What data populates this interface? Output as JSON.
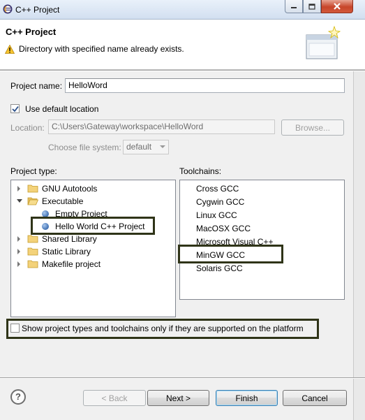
{
  "window": {
    "title": "C++ Project",
    "close_glyph": "x"
  },
  "header": {
    "title": "C++ Project",
    "message": "Directory with specified name already exists."
  },
  "project_name": {
    "label": "Project name:",
    "value": "HelloWord"
  },
  "use_default_location": {
    "label": "Use default location",
    "checked": true
  },
  "location": {
    "label": "Location:",
    "value": "C:\\Users\\Gateway\\workspace\\HelloWord",
    "browse_label": "Browse..."
  },
  "file_system": {
    "label": "Choose file system:",
    "value": "default"
  },
  "project_type": {
    "label": "Project type:",
    "items": [
      {
        "label": "GNU Autotools",
        "expanded": false
      },
      {
        "label": "Executable",
        "expanded": true
      },
      {
        "label": "Empty Project"
      },
      {
        "label": "Hello World C++ Project",
        "highlighted": true
      },
      {
        "label": "Shared Library",
        "expanded": false
      },
      {
        "label": "Static Library",
        "expanded": false
      },
      {
        "label": "Makefile project",
        "expanded": false
      }
    ]
  },
  "toolchains": {
    "label": "Toolchains:",
    "items": [
      "Cross GCC",
      "Cygwin GCC",
      "Linux GCC",
      "MacOSX GCC",
      "Microsoft Visual C++",
      "MinGW GCC",
      "Solaris GCC"
    ],
    "highlighted": "MinGW GCC"
  },
  "supported_only": {
    "label": "Show project types and toolchains only if they are supported on the platform",
    "checked": false
  },
  "buttons": {
    "help": "?",
    "back": "< Back",
    "next": "Next >",
    "finish": "Finish",
    "cancel": "Cancel"
  },
  "colors": {
    "highlight_box": "#2f3418",
    "window_bg": "#f0f0f0"
  }
}
